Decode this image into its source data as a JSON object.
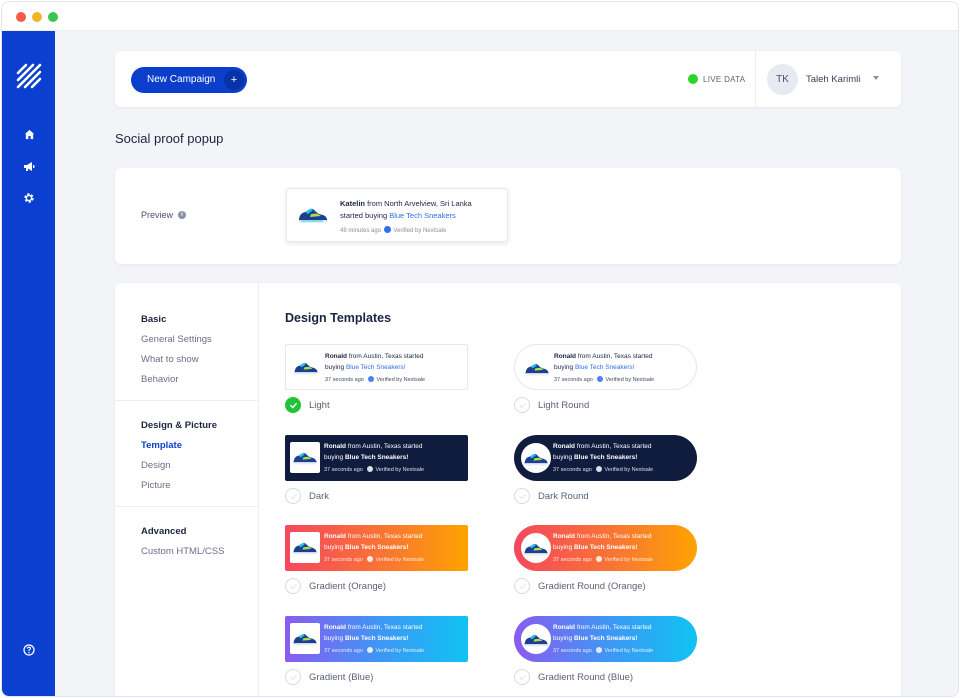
{
  "window": {
    "controls": [
      "close",
      "minimize",
      "maximize"
    ]
  },
  "sidebar": {
    "logo": "nextsale-logo",
    "items": [
      {
        "name": "home",
        "icon": "home-icon"
      },
      {
        "name": "campaigns",
        "icon": "megaphone-icon"
      },
      {
        "name": "settings",
        "icon": "gear-icon"
      }
    ],
    "help_icon": "help-icon",
    "bg_color": "#0a3fd0"
  },
  "topbar": {
    "new_campaign_label": "New Campaign",
    "new_campaign_plus": "+",
    "live_label": "LIVE DATA",
    "user_initials": "TK",
    "user_name": "Taleh Karimli"
  },
  "page_title": "Social proof popup",
  "preview": {
    "label": "Preview",
    "info_icon": "i",
    "popup": {
      "name": "Katelin",
      "from_text": " from North Arvelview, Sri Lanka",
      "started": "started buying ",
      "product": "Blue Tech Sneakers",
      "time": "48 minutes ago",
      "verified": "Verified by Nextsale"
    }
  },
  "nav": {
    "basic": {
      "heading": "Basic",
      "items": [
        "General Settings",
        "What to show",
        "Behavior"
      ]
    },
    "design": {
      "heading": "Design & Picture",
      "items": [
        "Template",
        "Design",
        "Picture"
      ],
      "active": "Template"
    },
    "advanced": {
      "heading": "Advanced",
      "items": [
        "Custom HTML/CSS"
      ]
    }
  },
  "design_templates": {
    "title": "Design Templates",
    "sample": {
      "name": "Ronald",
      "from_text": " from Austin, Texas started",
      "buying": "buying ",
      "product": "Blue Tech Sneakers!",
      "time": "37 seconds ago",
      "verified": "Verified by Nextsale"
    },
    "options": [
      {
        "label": "Light",
        "selected": true
      },
      {
        "label": "Light Round",
        "selected": false
      },
      {
        "label": "Dark",
        "selected": false
      },
      {
        "label": "Dark Round",
        "selected": false
      },
      {
        "label": "Gradient (Orange)",
        "selected": false
      },
      {
        "label": "Gradient Round (Orange)",
        "selected": false
      },
      {
        "label": "Gradient (Blue)",
        "selected": false
      },
      {
        "label": "Gradient Round (Blue)",
        "selected": false
      }
    ]
  },
  "colors": {
    "accent": "#0b3ecb",
    "live": "#2bd52b",
    "selected": "#1fc337",
    "dark_template": "#0f1c3d"
  }
}
